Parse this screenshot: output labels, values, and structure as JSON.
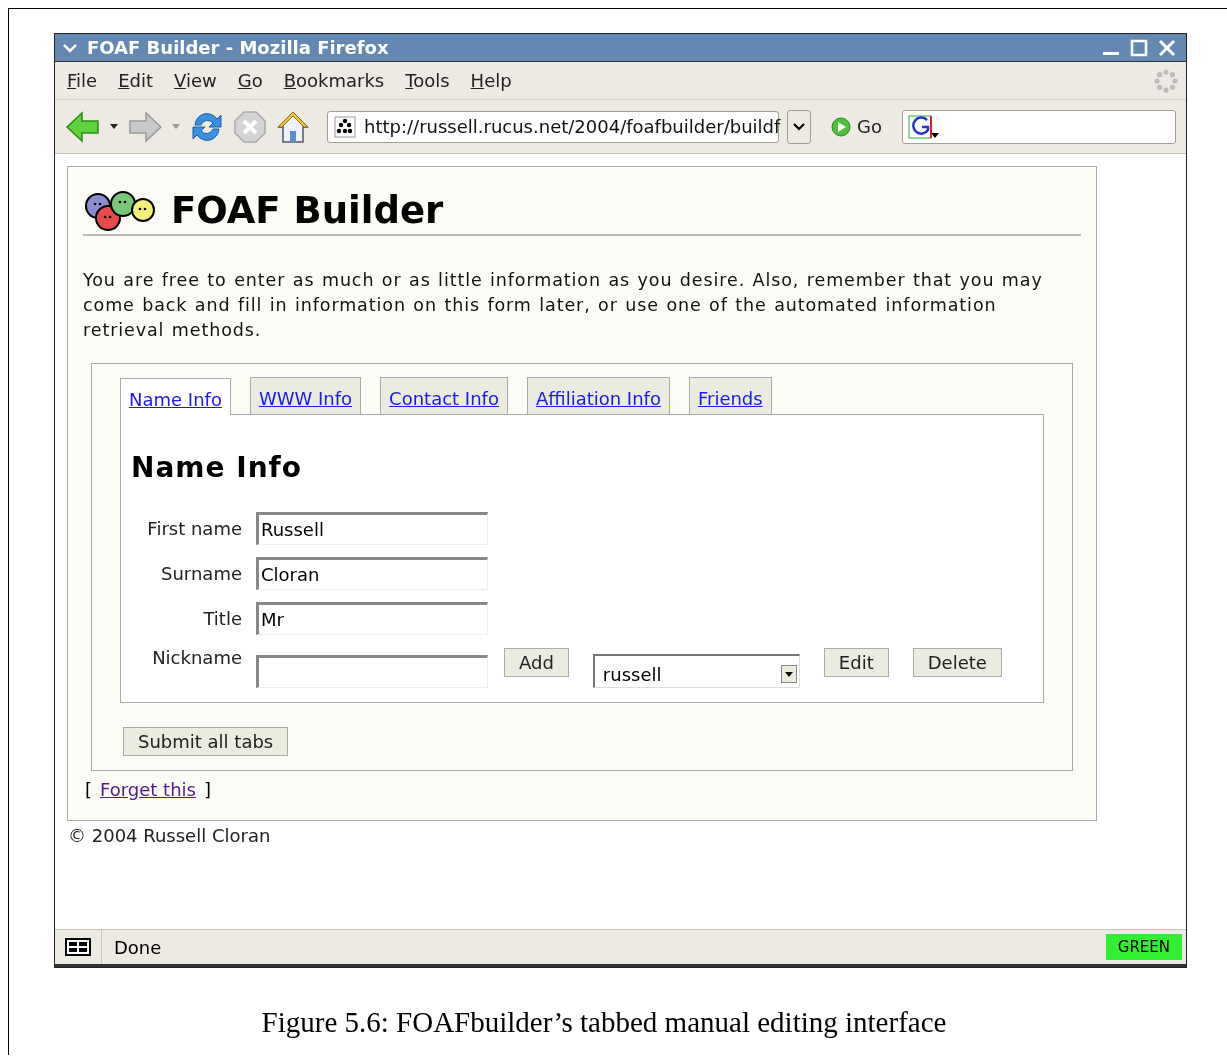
{
  "window": {
    "title": "FOAF Builder - Mozilla Firefox"
  },
  "menu": [
    "File",
    "Edit",
    "View",
    "Go",
    "Bookmarks",
    "Tools",
    "Help"
  ],
  "toolbar": {
    "url": "http://russell.rucus.net/2004/foafbuilder/buildf",
    "go": "Go"
  },
  "page": {
    "heading": "FOAF Builder",
    "intro": "You are free to enter as much or as little information as you desire. Also, remember that you may come back and fill in information on this form later, or use one of the automated information retrieval methods.",
    "tabs": [
      {
        "label": "Name Info",
        "selected": true
      },
      {
        "label": "WWW Info",
        "selected": false
      },
      {
        "label": "Contact Info",
        "selected": false
      },
      {
        "label": "Affiliation Info",
        "selected": false
      },
      {
        "label": "Friends",
        "selected": false
      }
    ],
    "panel_title": "Name Info",
    "fields": [
      {
        "label": "First name",
        "value": "Russell"
      },
      {
        "label": "Surname",
        "value": "Cloran"
      },
      {
        "label": "Title",
        "value": "Mr"
      }
    ],
    "nickname": {
      "label": "Nickname",
      "add": "Add",
      "choice": "russell",
      "edit": "Edit",
      "delete": "Delete"
    },
    "submit": "Submit all tabs",
    "forget": {
      "open": "[",
      "link": "Forget this",
      "close": "]"
    },
    "footer": "© 2004 Russell Cloran"
  },
  "status_bar": {
    "text": "Done",
    "indicator": "GREEN"
  },
  "caption": "Figure 5.6: FOAFbuilder’s tabbed manual editing interface"
}
